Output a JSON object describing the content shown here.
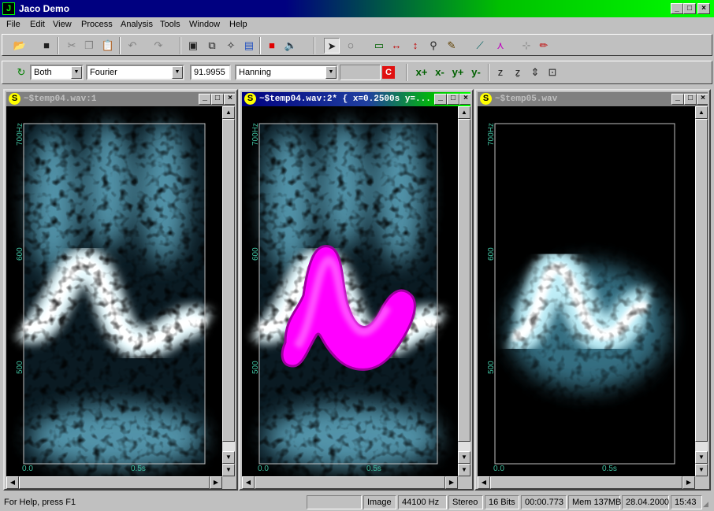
{
  "app": {
    "title": "Jaco Demo",
    "icon": "jaco-app-icon"
  },
  "menu": [
    "File",
    "Edit",
    "View",
    "Process",
    "Analysis",
    "Tools",
    "Window",
    "Help"
  ],
  "toolbar1": {
    "icons": [
      "open-folder-icon",
      "save-icon",
      "cut-icon",
      "copy-icon",
      "paste-icon",
      "undo-icon",
      "redo-icon",
      "new-window-icon",
      "export-icon",
      "magic-wand-icon",
      "mixer-icon",
      "stop-icon",
      "speaker-icon",
      "pointer-icon",
      "lasso-icon",
      "rectangle-select-icon",
      "horizontal-measure-icon",
      "vertical-measure-icon",
      "zoom-icon",
      "brush-icon",
      "line-icon",
      "pen-fork-icon",
      "marker-icon",
      "pencil-icon"
    ]
  },
  "toolbar2": {
    "channel": "Both",
    "transform": "Fourier",
    "value": "91.9955",
    "window": "Hanning",
    "c_button": "C",
    "zoom_labels": [
      "x+",
      "x-",
      "y+",
      "y-"
    ]
  },
  "windows": [
    {
      "title": "~$temp04.wav:1",
      "active": false,
      "y_labels": [
        "700Hz",
        "600",
        "500"
      ],
      "x_labels": [
        "0.0",
        "0.5s"
      ]
    },
    {
      "title": "~$temp04.wav:2*  {  x=0.2500s  y=...",
      "active": true,
      "y_labels": [
        "700Hz",
        "600",
        "500"
      ],
      "x_labels": [
        "0.0",
        "0.5s"
      ]
    },
    {
      "title": "~$temp05.wav",
      "active": false,
      "y_labels": [
        "700Hz",
        "600",
        "500"
      ],
      "x_labels": [
        "0.0",
        "0.5s"
      ]
    }
  ],
  "status": {
    "help": "For Help, press F1",
    "mode": "Image",
    "rate": "44100 Hz",
    "channels": "Stereo",
    "bits": "16 Bits",
    "time": "00:00.773",
    "mem": "Mem 137MB",
    "date": "28.04.2000",
    "clock": "15:43"
  },
  "colors": {
    "accent": "#000080",
    "selection": "#ff00ff",
    "spectro_light": "#e0f8ff",
    "spectro_mid": "#5aa0b8"
  }
}
